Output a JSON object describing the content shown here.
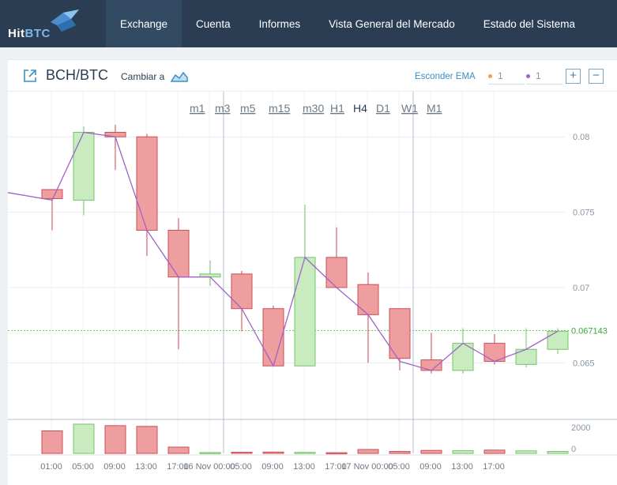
{
  "brand": {
    "part1": "Hit",
    "part2": "BTC"
  },
  "nav": [
    {
      "label": "Exchange",
      "active": true
    },
    {
      "label": "Cuenta",
      "active": false
    },
    {
      "label": "Informes",
      "active": false
    },
    {
      "label": "Vista General del Mercado",
      "active": false
    },
    {
      "label": "Estado del Sistema",
      "active": false
    }
  ],
  "panel": {
    "pair": "BCH/BTC",
    "switch_label": "Cambiar a",
    "ema_toggle": "Esconder EMA",
    "ema_values": [
      {
        "value": "1",
        "color": "#f0a050"
      },
      {
        "value": "1",
        "color": "#a060d0"
      }
    ],
    "zoom_in": "+",
    "zoom_out": "−"
  },
  "timeframes": [
    {
      "label": "m1",
      "active": false
    },
    {
      "label": "m3",
      "active": false
    },
    {
      "label": "m5",
      "active": false
    },
    {
      "label": "m15",
      "active": false
    },
    {
      "label": "m30",
      "active": false
    },
    {
      "label": "H1",
      "active": false
    },
    {
      "label": "H4",
      "active": true
    },
    {
      "label": "D1",
      "active": false
    },
    {
      "label": "W1",
      "active": false
    },
    {
      "label": "M1",
      "active": false
    }
  ],
  "chart_data": {
    "type": "candlestick",
    "x_labels": [
      "01:00",
      "05:00",
      "09:00",
      "13:00",
      "17:00",
      "16 Nov 00:00",
      "05:00",
      "09:00",
      "13:00",
      "17:00",
      "17 Nov 00:00",
      "05:00",
      "09:00",
      "13:00",
      "17:00"
    ],
    "y_ticks": [
      0.08,
      0.075,
      0.07,
      0.065
    ],
    "y_range": [
      0.0613,
      0.083
    ],
    "current_price": "0.067143",
    "volume_ticks": [
      "2000",
      "0"
    ],
    "volume_range": [
      0,
      2000
    ],
    "colors": {
      "up_fill": "#c8ecc0",
      "up_border": "#74c46a",
      "down_fill": "#ee9e9e",
      "down_border": "#cc4e58",
      "ema": "#a062c8",
      "price_line": "#66cc66"
    },
    "ema_start": 0.0763,
    "candles": [
      {
        "o": 0.0765,
        "h": 0.0765,
        "l": 0.0738,
        "c": 0.0759,
        "v": 1500,
        "ema": 0.0758
      },
      {
        "o": 0.0758,
        "h": 0.0807,
        "l": 0.0748,
        "c": 0.0803,
        "v": 1950,
        "ema": 0.0803
      },
      {
        "o": 0.0803,
        "h": 0.0808,
        "l": 0.0778,
        "c": 0.08,
        "v": 1850,
        "ema": 0.08
      },
      {
        "o": 0.08,
        "h": 0.0802,
        "l": 0.0721,
        "c": 0.0738,
        "v": 1800,
        "ema": 0.0738
      },
      {
        "o": 0.0738,
        "h": 0.0746,
        "l": 0.0659,
        "c": 0.0707,
        "v": 420,
        "ema": 0.0707
      },
      {
        "o": 0.0707,
        "h": 0.0718,
        "l": 0.0701,
        "c": 0.0709,
        "v": 60,
        "ema": 0.0707
      },
      {
        "o": 0.0709,
        "h": 0.0711,
        "l": 0.0671,
        "c": 0.0686,
        "v": 80,
        "ema": 0.0686
      },
      {
        "o": 0.0686,
        "h": 0.0688,
        "l": 0.0649,
        "c": 0.0648,
        "v": 90,
        "ema": 0.0648
      },
      {
        "o": 0.0648,
        "h": 0.0755,
        "l": 0.0648,
        "c": 0.072,
        "v": 70,
        "ema": 0.072
      },
      {
        "o": 0.072,
        "h": 0.074,
        "l": 0.07,
        "c": 0.07,
        "v": 50,
        "ema": 0.07
      },
      {
        "o": 0.0702,
        "h": 0.071,
        "l": 0.065,
        "c": 0.0682,
        "v": 260,
        "ema": 0.0682
      },
      {
        "o": 0.0686,
        "h": 0.0686,
        "l": 0.0645,
        "c": 0.0653,
        "v": 130,
        "ema": 0.0651
      },
      {
        "o": 0.0652,
        "h": 0.067,
        "l": 0.0643,
        "c": 0.0645,
        "v": 200,
        "ema": 0.0645
      },
      {
        "o": 0.0645,
        "h": 0.0673,
        "l": 0.0643,
        "c": 0.0663,
        "v": 180,
        "ema": 0.0663
      },
      {
        "o": 0.0663,
        "h": 0.0669,
        "l": 0.0649,
        "c": 0.0651,
        "v": 220,
        "ema": 0.0651
      },
      {
        "o": 0.0649,
        "h": 0.0673,
        "l": 0.0647,
        "c": 0.0659,
        "v": 170,
        "ema": 0.0659
      },
      {
        "o": 0.0659,
        "h": 0.0673,
        "l": 0.0656,
        "c": 0.0671,
        "v": 130,
        "ema": 0.0671
      }
    ],
    "markers": [
      {
        "after_candle": 6,
        "label": "16 Nov 00:00"
      },
      {
        "after_candle": 12,
        "label": "17 Nov 00:00"
      }
    ]
  }
}
